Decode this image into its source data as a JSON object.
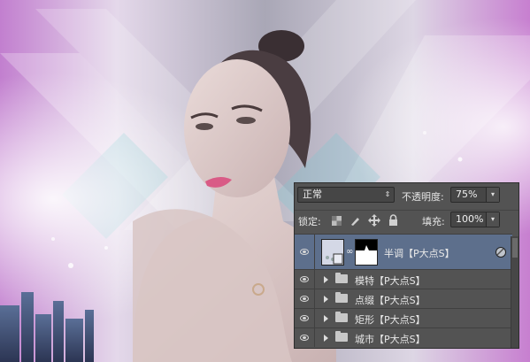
{
  "blend_mode": "正常",
  "opacity_label": "不透明度:",
  "opacity_value": "75%",
  "lock_label": "锁定:",
  "fill_label": "填充:",
  "fill_value": "100%",
  "layers": [
    {
      "name": "半调【P大点S】",
      "selected": true
    },
    {
      "name": "模特【P大点S】"
    },
    {
      "name": "点缀【P大点S】"
    },
    {
      "name": "矩形【P大点S】"
    },
    {
      "name": "城市【P大点S】"
    }
  ],
  "icons": {
    "lock_transparent": "checkerboard-icon",
    "lock_paint": "brush-icon",
    "lock_move": "move-icon",
    "lock_all": "padlock-icon",
    "visibility": "eye-icon",
    "group": "folder-icon"
  }
}
